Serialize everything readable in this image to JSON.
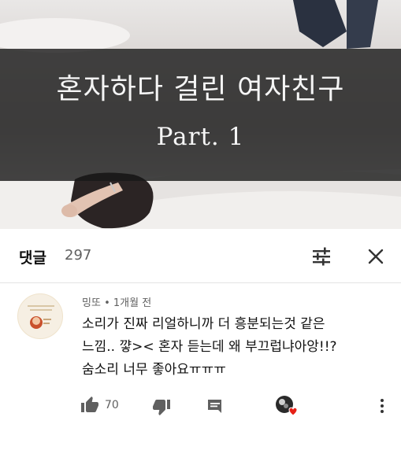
{
  "video": {
    "title_line1": "혼자하다 걸린 여자친구",
    "title_line2": "Part. 1"
  },
  "comments_header": {
    "label": "댓글",
    "count": "297",
    "sort_icon": "sort-sliders-icon",
    "close_icon": "close-icon"
  },
  "comment": {
    "author": "밍또",
    "separator": "•",
    "time": "1개월 전",
    "lines": [
      "소리가 진짜 리얼하니까 더 흥분되는것 같은",
      "느낌.. 꺟>< 혼자 듣는데 왜 부끄럽냐아앙!!?",
      "숨소리 너무 좋아요ㅠㅠㅠ"
    ],
    "like_count": "70",
    "icons": [
      "thumbs-up-icon",
      "thumbs-down-icon",
      "reply-icon",
      "creator-heart-icon",
      "more-vert-icon"
    ]
  },
  "colors": {
    "title_band": "#181818",
    "secondary_text": "#606060",
    "heart": "#e62117"
  }
}
